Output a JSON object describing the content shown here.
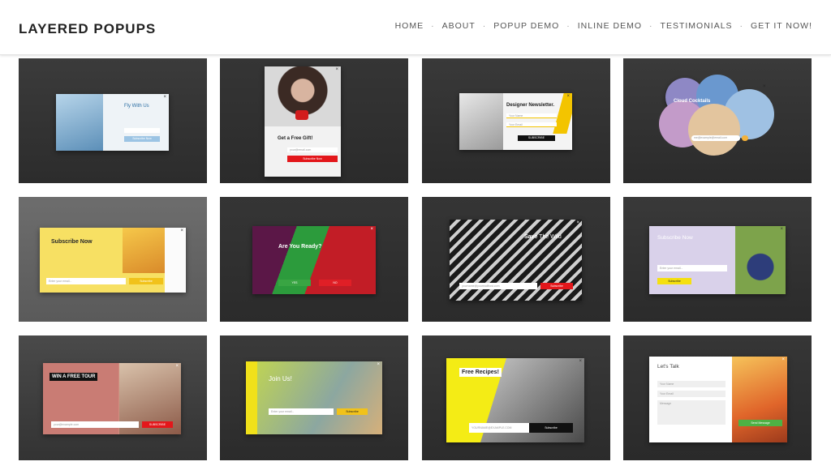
{
  "header": {
    "logo": "LAYERED POPUPS",
    "nav": [
      "HOME",
      "ABOUT",
      "POPUP DEMO",
      "INLINE DEMO",
      "TESTIMONIALS",
      "GET IT NOW!"
    ],
    "separator": "·"
  },
  "tiles": {
    "t1": {
      "title": "Fly With Us",
      "button": "Subscribe Now"
    },
    "t2": {
      "title": "Get a Free Gift!",
      "field": "your@email.com",
      "button": "Subscribe Now"
    },
    "t3": {
      "title": "Designer Newsletter.",
      "field1": "Your Name",
      "field2": "Your Email",
      "button": "SUBSCRIBE"
    },
    "t4": {
      "title": "Cloud Cocktails",
      "field": "me@example@email.com"
    },
    "t5": {
      "title": "Subscribe Now",
      "field": "Enter your email...",
      "button": "Subscribe"
    },
    "t6": {
      "title": "Are You Ready?",
      "yes": "YES",
      "no": "NO"
    },
    "t7": {
      "title_bold": "Save",
      "title_rest": " The Wild",
      "field": "yourname@yourmailhost.com",
      "button": "Subscribe"
    },
    "t8": {
      "title": "Subscribe Now",
      "field": "Enter your email...",
      "button": "Subscribe"
    },
    "t9": {
      "title": "WIN A FREE TOUR",
      "field": "your@example.com",
      "button": "SUBSCRIBE"
    },
    "t10": {
      "title": "Join Us!",
      "field": "Enter your email...",
      "button": "Subscribe"
    },
    "t11": {
      "title": "Free Recipes!",
      "field": "YOURNAME@EXAMPLE.COM",
      "button": "Subscribe"
    },
    "t12": {
      "title": "Let's Talk",
      "f1": "Your Name",
      "f2": "Your Email",
      "f3": "Message",
      "button": "Send Message"
    }
  },
  "colors": {
    "tile_bg": "#3a3a3a",
    "red": "#e3171b",
    "yellow": "#f4dc00",
    "green": "#4db144"
  }
}
